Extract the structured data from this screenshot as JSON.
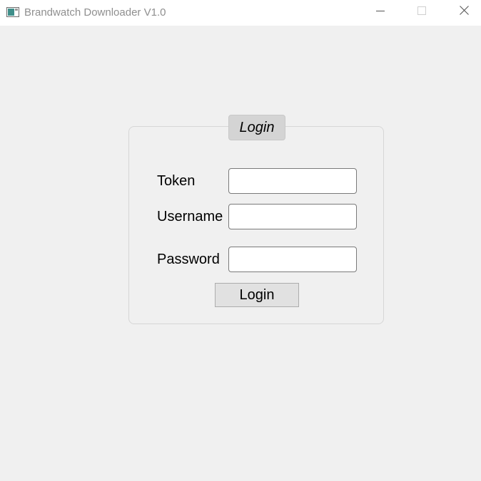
{
  "window": {
    "title": "Brandwatch Downloader V1.0",
    "controls": {
      "minimize_icon": "minimize-icon",
      "maximize_icon": "maximize-icon",
      "close_icon": "close-icon"
    }
  },
  "login": {
    "group_title": "Login",
    "fields": [
      {
        "label": "Token",
        "value": "",
        "placeholder": ""
      },
      {
        "label": "Username",
        "value": "",
        "placeholder": ""
      },
      {
        "label": "Password",
        "value": "",
        "placeholder": ""
      }
    ],
    "button_label": "Login"
  },
  "colors": {
    "background": "#f0f0f0",
    "titlebar": "#ffffff",
    "group_title_bg": "#d4d4d4",
    "button_bg": "#e1e1e1"
  }
}
